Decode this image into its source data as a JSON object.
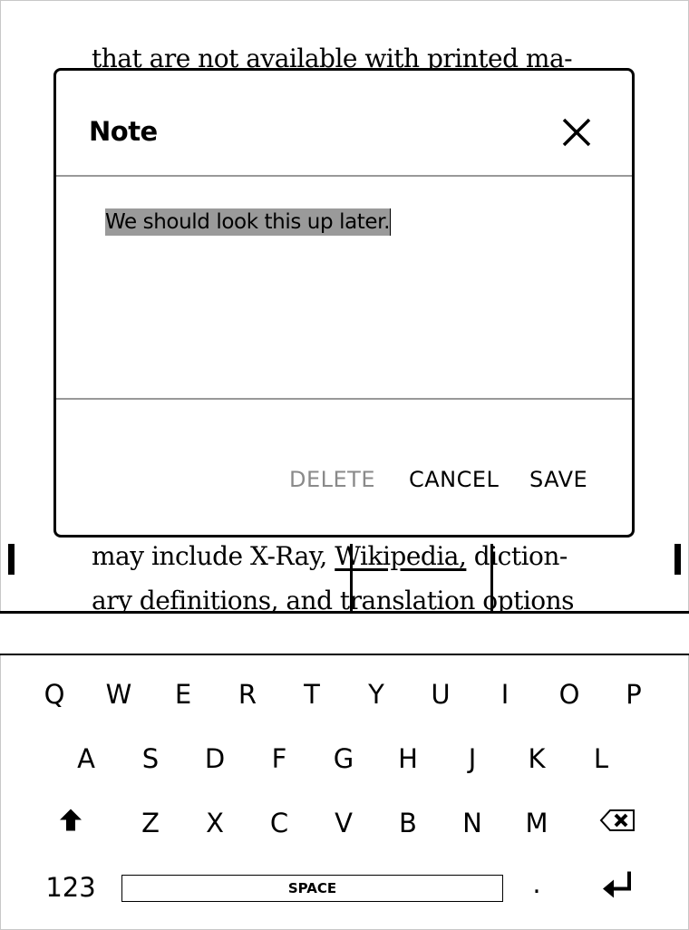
{
  "book": {
    "line_top": "that are not available with printed ma-",
    "line_mid_before": "may include X-Ray, ",
    "line_mid_selected": "Wikipedia,",
    "line_mid_after": " diction-",
    "line_bottom": "ary definitions, and translation options"
  },
  "dialog": {
    "title": "Note",
    "close_icon": "close-icon",
    "note_text": "We should look this up later.",
    "delete_label": "DELETE",
    "cancel_label": "CANCEL",
    "save_label": "SAVE",
    "disabled_color": "#8a8a8a"
  },
  "keyboard": {
    "row1": [
      "Q",
      "W",
      "E",
      "R",
      "T",
      "Y",
      "U",
      "I",
      "O",
      "P"
    ],
    "row2": [
      "A",
      "S",
      "D",
      "F",
      "G",
      "H",
      "J",
      "K",
      "L"
    ],
    "row3": [
      "Z",
      "X",
      "C",
      "V",
      "B",
      "N",
      "M"
    ],
    "shift_icon": "shift-arrow-icon",
    "backspace_icon": "backspace-icon",
    "numbers_label": "123",
    "space_label": "SPACE",
    "period_label": ".",
    "enter_icon": "enter-icon"
  }
}
